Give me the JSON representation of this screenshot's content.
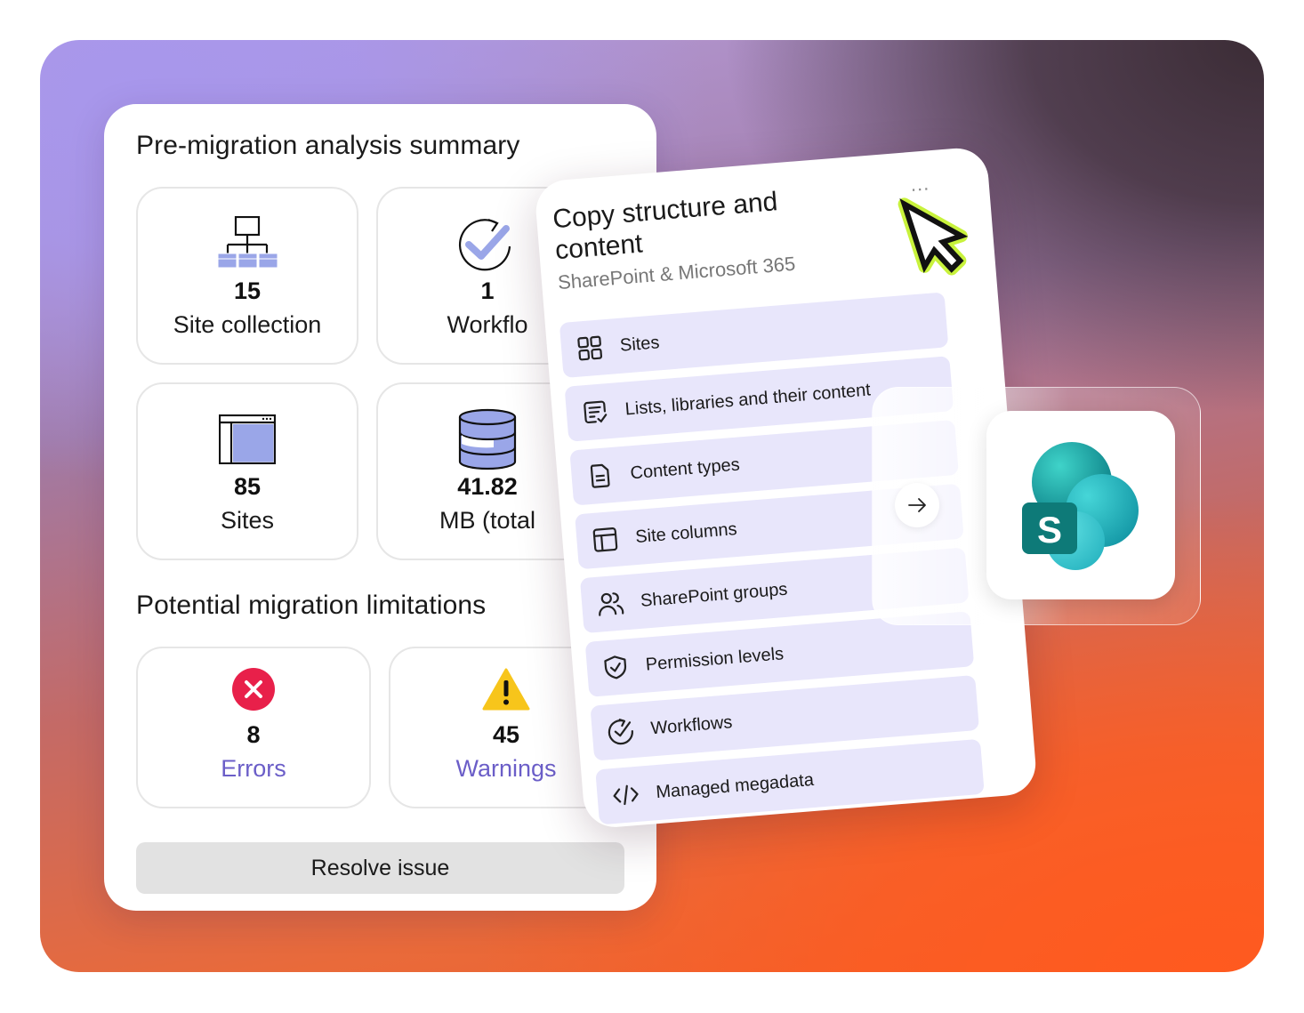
{
  "summary": {
    "title": "Pre-migration analysis summary",
    "stats": [
      {
        "icon": "sitemap-icon",
        "value": "15",
        "label": "Site collection"
      },
      {
        "icon": "workflow-icon",
        "value": "1",
        "label": "Workflo"
      },
      {
        "icon": "browser-window-icon",
        "value": "85",
        "label": "Sites"
      },
      {
        "icon": "database-icon",
        "value": "41.82",
        "label": "MB (total"
      }
    ],
    "limitations_title": "Potential migration limitations",
    "limitations": [
      {
        "icon": "error-icon",
        "value": "8",
        "label": "Errors",
        "color": "#e8204a"
      },
      {
        "icon": "warning-icon",
        "value": "45",
        "label": "Warnings",
        "color": "#f7c51b"
      }
    ],
    "resolve_label": "Resolve issue"
  },
  "copy": {
    "title": "Copy structure and content",
    "subtitle": "SharePoint & Microsoft 365",
    "menu_dots": "...",
    "items": [
      {
        "icon": "grid-icon",
        "label": "Sites"
      },
      {
        "icon": "list-check-icon",
        "label": "Lists, libraries and their content"
      },
      {
        "icon": "document-icon",
        "label": "Content types"
      },
      {
        "icon": "columns-icon",
        "label": "Site columns"
      },
      {
        "icon": "users-icon",
        "label": "SharePoint groups"
      },
      {
        "icon": "shield-check-icon",
        "label": "Permission levels"
      },
      {
        "icon": "workflow-icon",
        "label": "Workflows"
      },
      {
        "icon": "code-icon",
        "label": "Managed megadata"
      }
    ]
  },
  "sharepoint": {
    "letter": "S",
    "arrow": "→"
  },
  "colors": {
    "accent_purple": "#6b5ec8",
    "item_bg": "#e8e6fb",
    "icon_blue": "#9aa6e8",
    "cursor_green": "#c8f23c",
    "sp_teal": "#0f8b8d"
  }
}
